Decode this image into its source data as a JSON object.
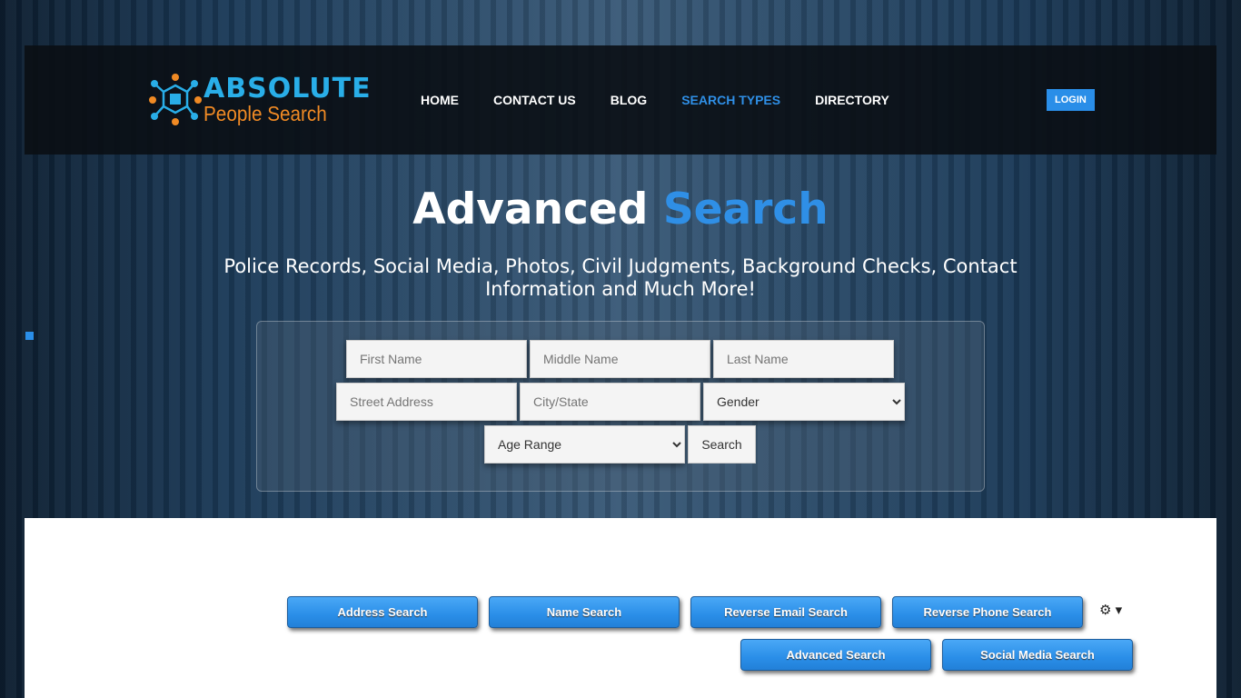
{
  "header": {
    "logo_top": "ABSOLUTE",
    "logo_bottom": "People Search",
    "nav": [
      "HOME",
      "CONTACT US",
      "BLOG",
      "SEARCH TYPES",
      "DIRECTORY"
    ],
    "active": "SEARCH TYPES",
    "login": "LOGIN"
  },
  "hero": {
    "title_white": "Advanced",
    "title_blue": "Search",
    "subtitle": "Police Records, Social Media, Photos, Civil Judgments, Background Checks, Contact Information and Much More!"
  },
  "form": {
    "first": "First Name",
    "middle": "Middle Name",
    "last": "Last Name",
    "street": "Street Address",
    "city": "City/State",
    "gender": "Gender",
    "age": "Age Range",
    "search": "Search"
  },
  "buttons": [
    "Address Search",
    "Name Search",
    "Reverse Email Search",
    "Reverse Phone Search",
    "Advanced Search",
    "Social Media Search"
  ],
  "colors": {
    "accent": "#2a8ee8",
    "logo_blue": "#29aee8",
    "logo_orange": "#f08a24"
  }
}
